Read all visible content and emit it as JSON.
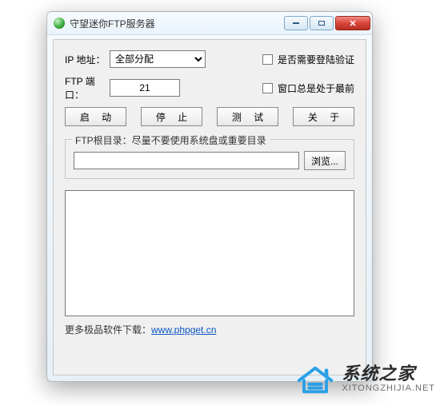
{
  "window": {
    "title": "守望迷你FTP服务器"
  },
  "form": {
    "ip_label": "IP 地址：",
    "ip_options": [
      "全部分配"
    ],
    "ip_selected": "全部分配",
    "login_required_label": "是否需要登陆验证",
    "port_label": "FTP 端口：",
    "port_value": "21",
    "topmost_label": "窗口总是处于最前"
  },
  "buttons": {
    "start": "启 动",
    "stop": "停 止",
    "test": "测 试",
    "about": "关 于"
  },
  "rootdir": {
    "legend": "FTP根目录：尽量不要使用系统盘或重要目录",
    "path": "",
    "browse": "浏览..."
  },
  "log": "",
  "footer": {
    "prefix": "更多极品软件下载：",
    "link_text": "www.phpget.cn"
  },
  "watermark": {
    "cn": "系统之家",
    "en": "XITONGZHIJIA.NET"
  }
}
